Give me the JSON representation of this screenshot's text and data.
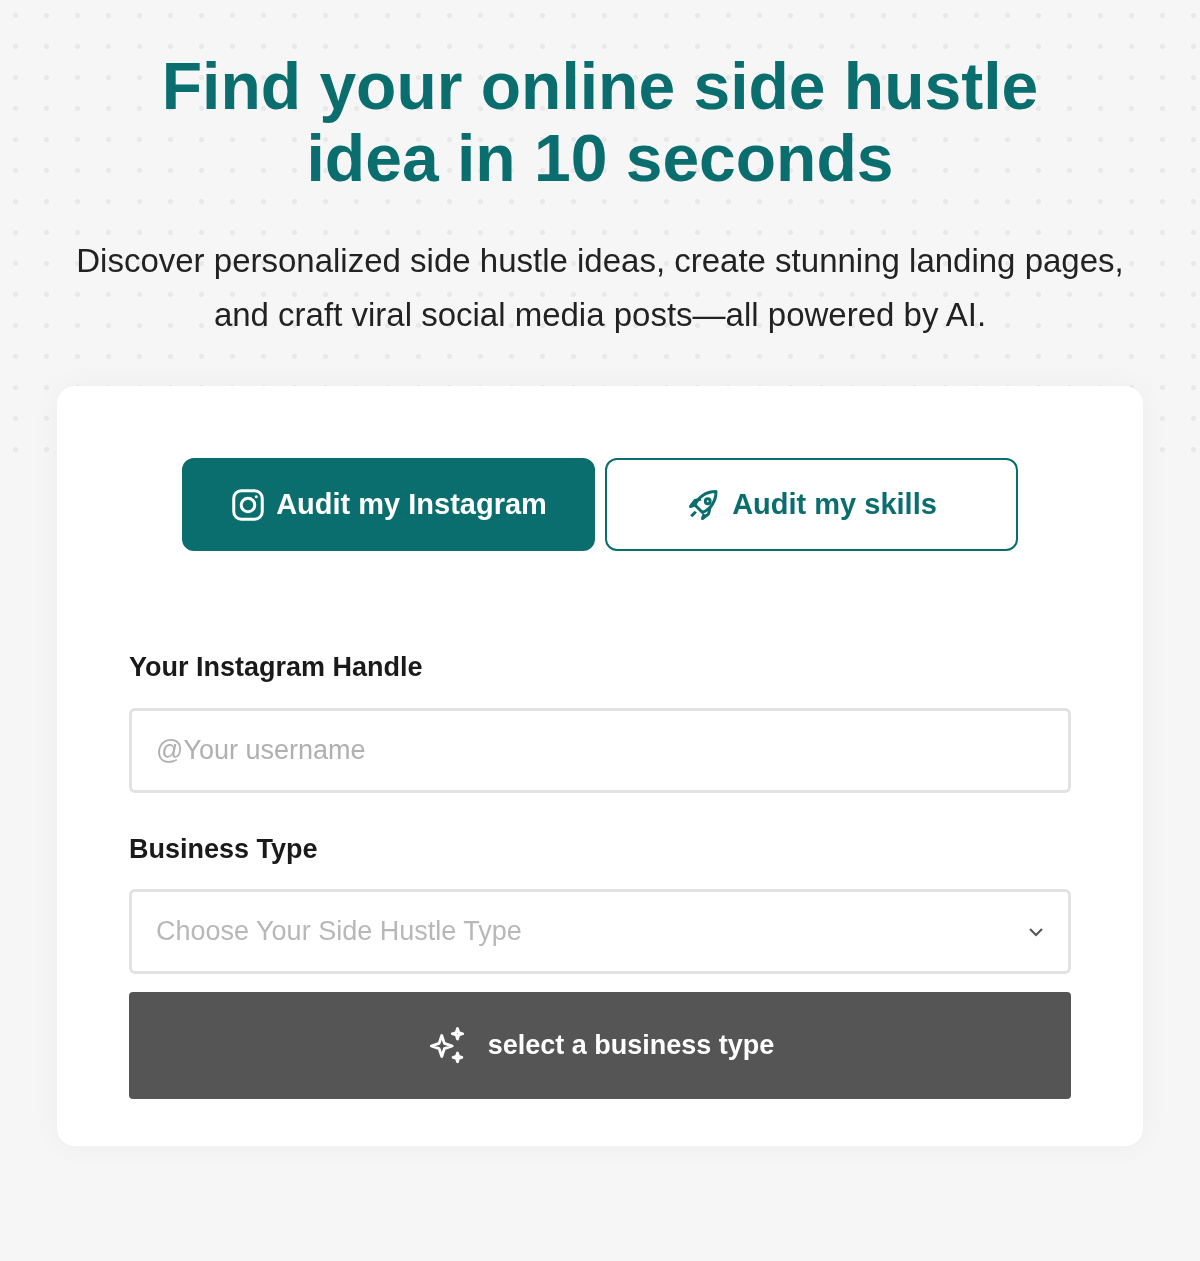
{
  "hero": {
    "title_lines": [
      "Find your online side hustle",
      "idea in 10 seconds"
    ],
    "subtitle": "Discover personalized side hustle ideas, create stunning landing pages, and craft viral social media posts—all powered by AI."
  },
  "tabs": [
    {
      "label": "Audit my Instagram",
      "kind": "instagram",
      "selected": true
    },
    {
      "label": "Audit my skills",
      "kind": "rocket",
      "selected": false
    }
  ],
  "form": {
    "handle": {
      "label": "Your Instagram Handle",
      "placeholder": "@Your username"
    },
    "business_type": {
      "label": "Business Type",
      "placeholder": "Choose Your Side Hustle Type"
    },
    "submit": {
      "label": "select a business type"
    }
  }
}
